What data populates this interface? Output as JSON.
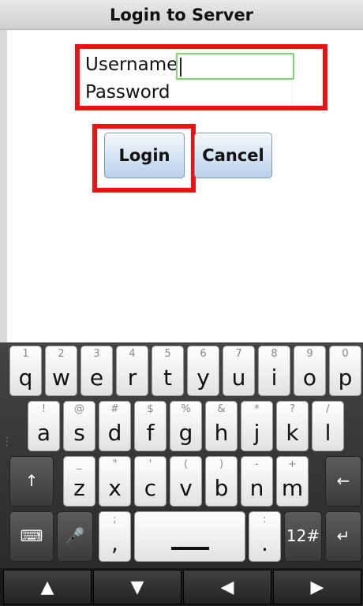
{
  "window": {
    "title": "Login to Server"
  },
  "form": {
    "username_label": "Username",
    "password_label": "Password",
    "username_value": "",
    "password_value": "",
    "login_label": "Login",
    "cancel_label": "Cancel"
  },
  "keyboard": {
    "row1": [
      {
        "hint": "1",
        "main": "q"
      },
      {
        "hint": "2",
        "main": "w"
      },
      {
        "hint": "3",
        "main": "e"
      },
      {
        "hint": "4",
        "main": "r"
      },
      {
        "hint": "5",
        "main": "t"
      },
      {
        "hint": "6",
        "main": "y"
      },
      {
        "hint": "7",
        "main": "u"
      },
      {
        "hint": "8",
        "main": "i"
      },
      {
        "hint": "9",
        "main": "o"
      },
      {
        "hint": "0",
        "main": "p"
      }
    ],
    "row2": [
      {
        "hint": "!",
        "main": "a"
      },
      {
        "hint": "@",
        "main": "s"
      },
      {
        "hint": "#",
        "main": "d"
      },
      {
        "hint": "$",
        "main": "f"
      },
      {
        "hint": "%",
        "main": "g"
      },
      {
        "hint": "&",
        "main": "h"
      },
      {
        "hint": "*",
        "main": "j"
      },
      {
        "hint": "?",
        "main": "k"
      },
      {
        "hint": "/",
        "main": "l"
      }
    ],
    "row3": [
      {
        "hint": "_",
        "main": "z"
      },
      {
        "hint": "\"",
        "main": "x"
      },
      {
        "hint": "'",
        "main": "c"
      },
      {
        "hint": "(",
        "main": "v"
      },
      {
        "hint": ")",
        "main": "b"
      },
      {
        "hint": "-",
        "main": "n"
      },
      {
        "hint": "+",
        "main": "m"
      }
    ],
    "row4": {
      "comma": {
        "hint": ";",
        "main": ","
      },
      "period": {
        "hint": ":",
        "main": "."
      },
      "symbols": "12#"
    },
    "icons": {
      "shift": "↑",
      "backspace": "←",
      "keyboard_settings": "⌨",
      "microphone": "🎤",
      "enter": "↵"
    }
  },
  "navbar": {
    "up": "▲",
    "down": "▼",
    "left": "◀",
    "right": "▶"
  },
  "colors": {
    "highlight": "#ee1111",
    "focus_border": "#7bd86a",
    "button_gradient_bottom": "#b9d0ea"
  }
}
